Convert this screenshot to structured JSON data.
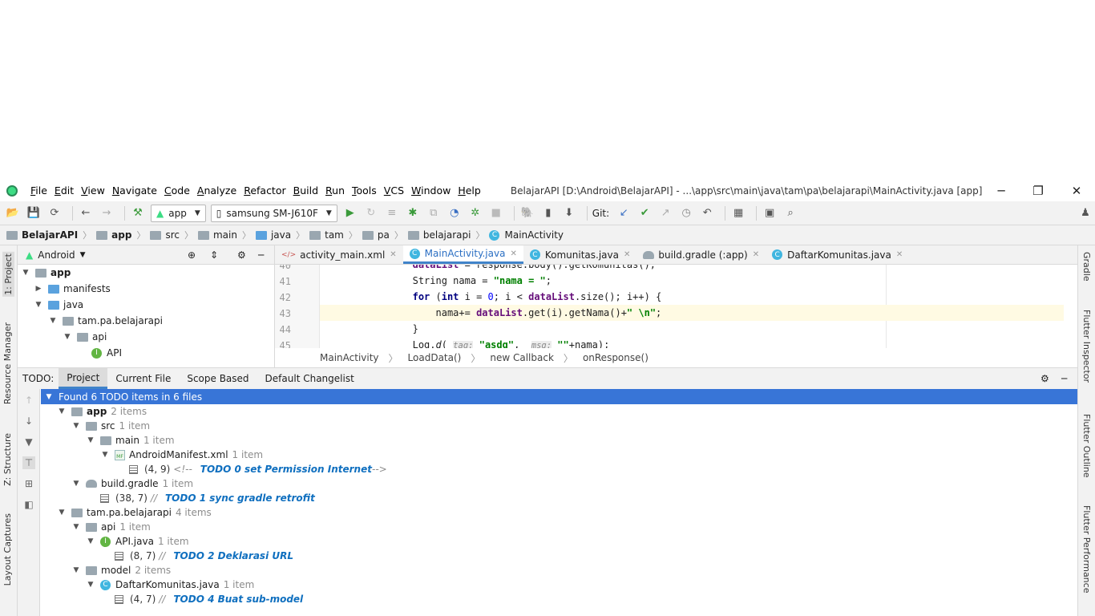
{
  "menu": [
    "File",
    "Edit",
    "View",
    "Navigate",
    "Code",
    "Analyze",
    "Refactor",
    "Build",
    "Run",
    "Tools",
    "VCS",
    "Window",
    "Help"
  ],
  "window_title": "BelajarAPI [D:\\Android\\BelajarAPI] - ...\\app\\src\\main\\java\\tam\\pa\\belajarapi\\MainActivity.java [app]",
  "window_controls": {
    "minimize": "─",
    "restore": "❐",
    "close": "✕"
  },
  "toolbar": {
    "run_config": "app",
    "device": "samsung SM-J610F",
    "git_label": "Git:"
  },
  "breadcrumbs": [
    "BelajarAPI",
    "app",
    "src",
    "main",
    "java",
    "tam",
    "pa",
    "belajarapi",
    "MainActivity"
  ],
  "left_stripe": {
    "project": "1: Project",
    "resource_manager": "Resource Manager",
    "structure": "Z: Structure",
    "layout_captures": "Layout Captures"
  },
  "right_stripe": {
    "gradle": "Gradle",
    "flutter_inspector": "Flutter Inspector",
    "flutter_outline": "Flutter Outline",
    "flutter_performance": "Flutter Performance"
  },
  "project_panel": {
    "view_mode": "Android",
    "tree": [
      {
        "label": "app",
        "level": 0,
        "kind": "module"
      },
      {
        "label": "manifests",
        "level": 1,
        "kind": "folder"
      },
      {
        "label": "java",
        "level": 1,
        "kind": "folder"
      },
      {
        "label": "tam.pa.belajarapi",
        "level": 2,
        "kind": "package"
      },
      {
        "label": "api",
        "level": 3,
        "kind": "package"
      },
      {
        "label": "API",
        "level": 4,
        "kind": "interface"
      }
    ]
  },
  "editor": {
    "tabs": [
      {
        "label": "activity_main.xml",
        "active": false
      },
      {
        "label": "MainActivity.java",
        "active": true
      },
      {
        "label": "Komunitas.java",
        "active": false
      },
      {
        "label": "build.gradle (:app)",
        "active": false
      },
      {
        "label": "DaftarKomunitas.java",
        "active": false
      }
    ],
    "line_numbers": [
      "40",
      "41",
      "42",
      "43",
      "44",
      "45"
    ],
    "code_crumbs": [
      "MainActivity",
      "LoadData()",
      "new Callback",
      "onResponse()"
    ]
  },
  "todo": {
    "title": "TODO:",
    "tabs": [
      "Project",
      "Current File",
      "Scope Based",
      "Default Changelist"
    ],
    "found": "Found 6 TODO items in 6 files",
    "nodes": [
      {
        "label": "app",
        "meta": "2 items"
      },
      {
        "label": "src",
        "meta": "1 item"
      },
      {
        "label": "main",
        "meta": "1 item"
      },
      {
        "label": "AndroidManifest.xml",
        "meta": "1 item"
      },
      {
        "loc": "(4, 9)",
        "prefix": "<!--",
        "text": "TODO 0 set Permission Internet",
        "suffix": "-->"
      },
      {
        "label": "build.gradle",
        "meta": "1 item"
      },
      {
        "loc": "(38, 7)",
        "prefix": "//",
        "text": "TODO 1 sync gradle retrofit"
      },
      {
        "label": "tam.pa.belajarapi",
        "meta": "4 items"
      },
      {
        "label": "api",
        "meta": "1 item"
      },
      {
        "label": "API.java",
        "meta": "1 item"
      },
      {
        "loc": "(8, 7)",
        "prefix": "//",
        "text": "TODO 2 Deklarasi URL"
      },
      {
        "label": "model",
        "meta": "2 items"
      },
      {
        "label": "DaftarKomunitas.java",
        "meta": "1 item"
      },
      {
        "loc": "(4, 7)",
        "prefix": "//",
        "text": "TODO 4 Buat sub-model"
      }
    ]
  },
  "colors": {
    "accent": "#4083c9",
    "selection": "#3875d7",
    "todo_text": "#0f6fbf",
    "line_highlight": "#fffae3"
  }
}
